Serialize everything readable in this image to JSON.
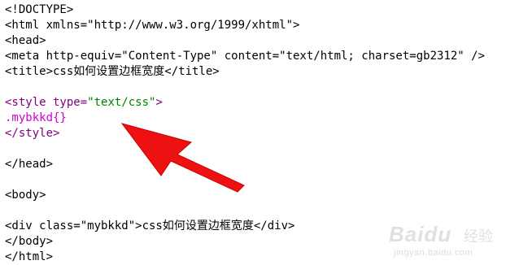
{
  "editor": {
    "lines": [
      {
        "tokens": [
          {
            "text": "<!DOCTYPE>",
            "color": "black"
          }
        ]
      },
      {
        "tokens": [
          {
            "text": "<html xmlns=\"http://www.w3.org/1999/xhtml\">",
            "color": "black"
          }
        ]
      },
      {
        "tokens": [
          {
            "text": "<head>",
            "color": "black"
          }
        ]
      },
      {
        "tokens": [
          {
            "text": "<meta http-equiv=\"Content-Type\" content=\"text/html; charset=gb2312\" />",
            "color": "black"
          }
        ]
      },
      {
        "tokens": [
          {
            "text": "<title>css如何设置边框宽度</title>",
            "color": "black"
          }
        ]
      },
      {
        "tokens": []
      },
      {
        "tokens": [
          {
            "text": "<style type=",
            "color": "purple"
          },
          {
            "text": "\"text/css\"",
            "color": "green"
          },
          {
            "text": ">",
            "color": "purple"
          }
        ]
      },
      {
        "tokens": [
          {
            "text": ".mybkkd{}",
            "color": "magenta"
          }
        ]
      },
      {
        "tokens": [
          {
            "text": "</style>",
            "color": "purple"
          }
        ]
      },
      {
        "tokens": []
      },
      {
        "tokens": [
          {
            "text": "</head>",
            "color": "black"
          }
        ]
      },
      {
        "tokens": []
      },
      {
        "tokens": [
          {
            "text": "<body>",
            "color": "black"
          }
        ]
      },
      {
        "tokens": []
      },
      {
        "tokens": [
          {
            "text": "<div class=\"mybkkd\">css如何设置边框宽度</div>",
            "color": "black"
          }
        ]
      },
      {
        "tokens": [
          {
            "text": "</body>",
            "color": "black"
          }
        ]
      },
      {
        "tokens": [
          {
            "text": "</html>",
            "color": "black"
          }
        ]
      }
    ]
  },
  "watermark": {
    "brand": "Baidu",
    "sub": "经验",
    "url": "jingyan.baidu.com"
  },
  "colors": {
    "black": "#000000",
    "purple": "#800080",
    "green": "#008000",
    "magenta": "#d000d0",
    "arrow": "#ee1111"
  },
  "icons": {
    "arrow": "red-pointer-arrow-icon"
  }
}
